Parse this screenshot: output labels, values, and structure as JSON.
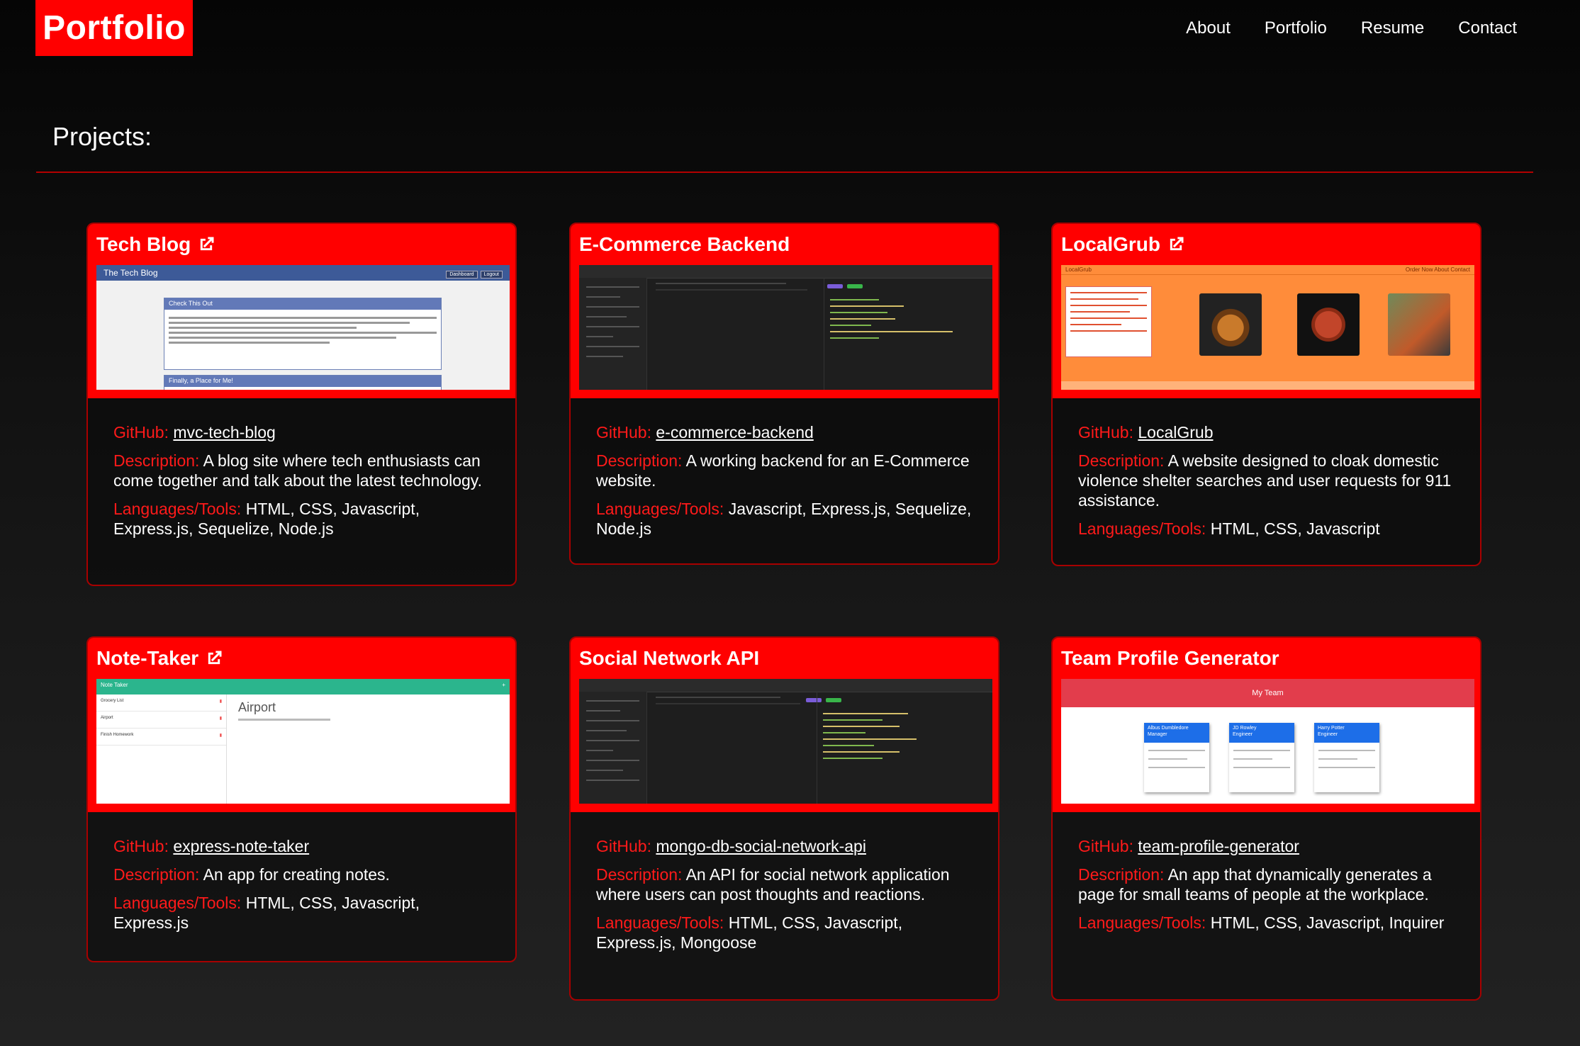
{
  "header": {
    "brand": "Portfolio",
    "nav": [
      "About",
      "Portfolio",
      "Resume",
      "Contact"
    ]
  },
  "section_title": "Projects:",
  "labels": {
    "github": "GitHub:",
    "description": "Description:",
    "languages": "Languages/Tools:"
  },
  "projects": [
    {
      "title": "Tech Blog",
      "has_link_icon": true,
      "github": "mvc-tech-blog",
      "description": "A blog site where tech enthusiasts can come together and talk about the latest technology.",
      "languages": "HTML, CSS, Javascript, Express.js, Sequelize, Node.js",
      "screenshot": {
        "app_title": "The Tech Blog",
        "buttons": [
          "Dashboard",
          "Logout"
        ],
        "post1_title": "Check This Out",
        "post2_title": "Finally, a Place for Me!"
      }
    },
    {
      "title": "E-Commerce Backend",
      "has_link_icon": false,
      "github": "e-commerce-backend",
      "description": "A working backend for an E-Commerce website.",
      "languages": "Javascript, Express.js, Sequelize, Node.js",
      "screenshot": {}
    },
    {
      "title": "LocalGrub",
      "has_link_icon": true,
      "github": "LocalGrub",
      "description": "A website designed to cloak domestic violence shelter searches and user requests for 911 assistance.",
      "languages": "HTML, CSS, Javascript",
      "screenshot": {
        "app_title": "LocalGrub",
        "nav": "Order Now   About   Contact"
      }
    },
    {
      "title": "Note-Taker",
      "has_link_icon": true,
      "github": "express-note-taker",
      "description": "An app for creating notes.",
      "languages": "HTML, CSS, Javascript, Express.js",
      "screenshot": {
        "app_title": "Note Taker",
        "notes": [
          "Grocery List",
          "Airport",
          "Finish Homework"
        ],
        "active_note": "Airport"
      }
    },
    {
      "title": "Social Network API",
      "has_link_icon": false,
      "github": "mongo-db-social-network-api",
      "description": "An API for social network application where users can post thoughts and reactions.",
      "languages": "HTML, CSS, Javascript, Express.js, Mongoose",
      "screenshot": {}
    },
    {
      "title": "Team Profile Generator",
      "has_link_icon": false,
      "github": "team-profile-generator",
      "description": "An app that dynamically generates a page for small teams of people at the workplace.",
      "languages": "HTML, CSS, Javascript, Inquirer",
      "screenshot": {
        "banner": "My Team",
        "members": [
          {
            "name": "Albus Dumbledore",
            "role": "Manager"
          },
          {
            "name": "JD Rowley",
            "role": "Engineer"
          },
          {
            "name": "Harry Potter",
            "role": "Engineer"
          }
        ]
      }
    }
  ],
  "colors": {
    "accent": "#ff0000",
    "label": "#ff1a1a",
    "border": "#a80000"
  }
}
